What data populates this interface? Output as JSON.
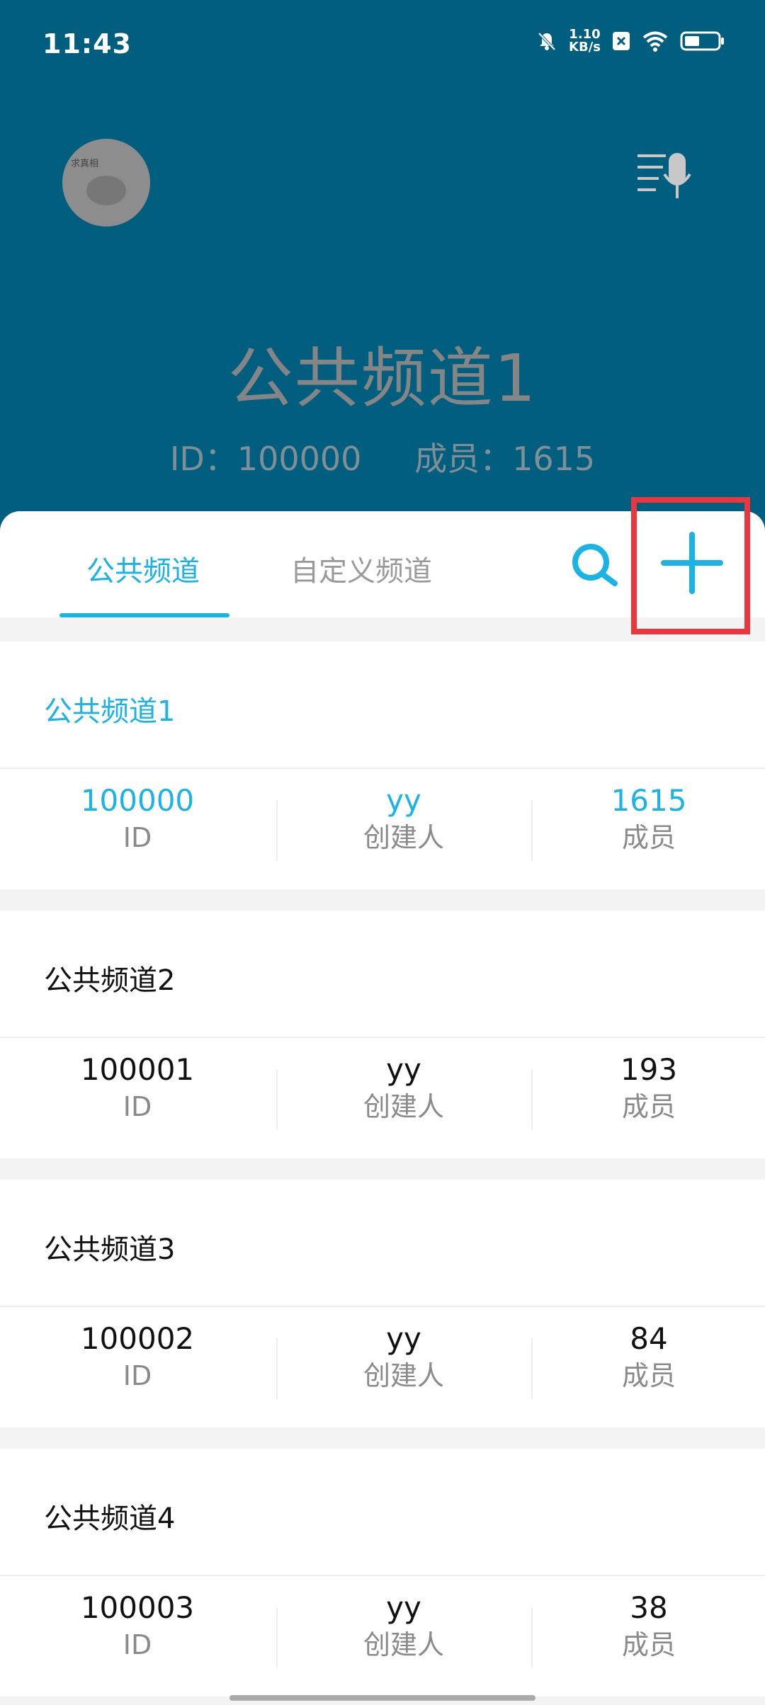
{
  "status_bar": {
    "time": "11:43",
    "net_speed_value": "1.10",
    "net_speed_unit": "KB/s"
  },
  "header": {
    "avatar_tag": "求真相",
    "channel_title": "公共频道1",
    "meta_id": "ID：100000",
    "meta_members": "成员：1615"
  },
  "tabs": [
    {
      "label": "公共频道",
      "active": true
    },
    {
      "label": "自定义频道",
      "active": false
    }
  ],
  "channels": [
    {
      "name": "公共频道1",
      "id": "100000",
      "creator": "yy",
      "members": "1615",
      "selected": true
    },
    {
      "name": "公共频道2",
      "id": "100001",
      "creator": "yy",
      "members": "193",
      "selected": false
    },
    {
      "name": "公共频道3",
      "id": "100002",
      "creator": "yy",
      "members": "84",
      "selected": false
    },
    {
      "name": "公共频道4",
      "id": "100003",
      "creator": "yy",
      "members": "38",
      "selected": false
    }
  ],
  "labels": {
    "id": "ID",
    "creator": "创建人",
    "members": "成员"
  },
  "colors": {
    "header_bg": "#015e7f",
    "accent": "#1bb3e6",
    "highlight": "#e8383d"
  },
  "icons": [
    "bell-off-icon",
    "close-box-icon",
    "wifi-icon",
    "battery-icon",
    "voice-list-icon",
    "search-icon",
    "add-icon"
  ]
}
